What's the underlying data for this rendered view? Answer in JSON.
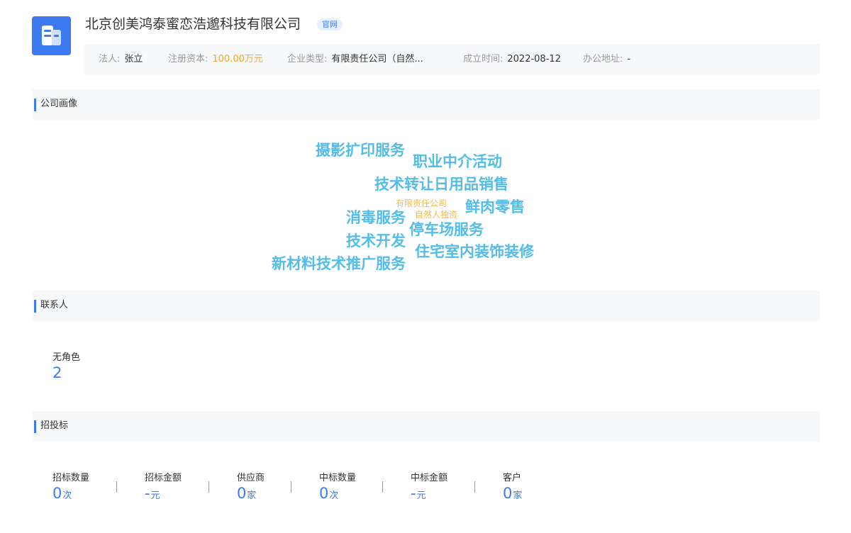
{
  "header": {
    "company_name": "北京创美鸿泰蜜恋浩邈科技有限公司",
    "official_tag": "官网",
    "logo_icon": "building-icon",
    "accent_color": "#3d7af0"
  },
  "info": {
    "legal_rep_label": "法人:",
    "legal_rep_value": "张立",
    "capital_label": "注册资本:",
    "capital_value": "100.00万元",
    "type_label": "企业类型:",
    "type_value": "有限责任公司（自然...",
    "founded_label": "成立时间:",
    "founded_value": "2022-08-12",
    "address_label": "办公地址:",
    "address_value": "-"
  },
  "portrait": {
    "title": "公司画像",
    "words": [
      "摄影扩印服务",
      "职业中介活动",
      "技术转让日用品销售",
      "有限责任公司",
      "自然人独资",
      "鲜肉零售",
      "消毒服务",
      "停车场服务",
      "技术开发",
      "住宅室内装饰装修",
      "新材料技术推广服务"
    ]
  },
  "contacts": {
    "title": "联系人",
    "role_label": "无角色",
    "role_count": "2"
  },
  "bidding": {
    "title": "招投标",
    "stats": [
      {
        "label": "招标数量",
        "value": "0",
        "unit": "次"
      },
      {
        "label": "招标金额",
        "value": "-",
        "unit": "元"
      },
      {
        "label": "供应商",
        "value": "0",
        "unit": "家"
      },
      {
        "label": "中标数量",
        "value": "0",
        "unit": "次"
      },
      {
        "label": "中标金额",
        "value": "-",
        "unit": "元"
      },
      {
        "label": "客户",
        "value": "0",
        "unit": "家"
      }
    ]
  }
}
